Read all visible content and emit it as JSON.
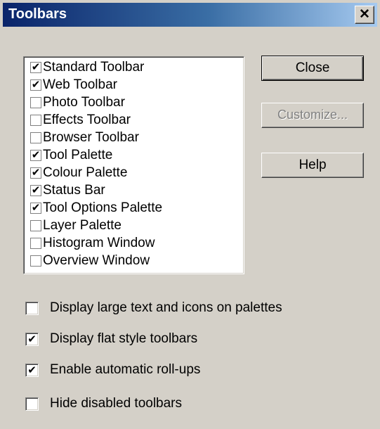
{
  "window": {
    "title": "Toolbars",
    "close_glyph": "✕"
  },
  "toolbars_list": [
    {
      "label": "Standard Toolbar",
      "checked": true
    },
    {
      "label": "Web Toolbar",
      "checked": true
    },
    {
      "label": "Photo Toolbar",
      "checked": false
    },
    {
      "label": "Effects Toolbar",
      "checked": false
    },
    {
      "label": "Browser Toolbar",
      "checked": false
    },
    {
      "label": "Tool Palette",
      "checked": true
    },
    {
      "label": "Colour Palette",
      "checked": true
    },
    {
      "label": "Status Bar",
      "checked": true
    },
    {
      "label": "Tool Options Palette",
      "checked": true
    },
    {
      "label": "Layer Palette",
      "checked": false
    },
    {
      "label": "Histogram Window",
      "checked": false
    },
    {
      "label": "Overview Window",
      "checked": false
    }
  ],
  "buttons": {
    "close": "Close",
    "customize": "Customize...",
    "help": "Help"
  },
  "options": [
    {
      "label": "Display large text and icons on palettes",
      "checked": false
    },
    {
      "label": "Display flat style toolbars",
      "checked": true
    },
    {
      "label": "Enable automatic roll-ups",
      "checked": true
    },
    {
      "label": "Hide disabled toolbars",
      "checked": false
    }
  ],
  "check_glyph": "✔"
}
